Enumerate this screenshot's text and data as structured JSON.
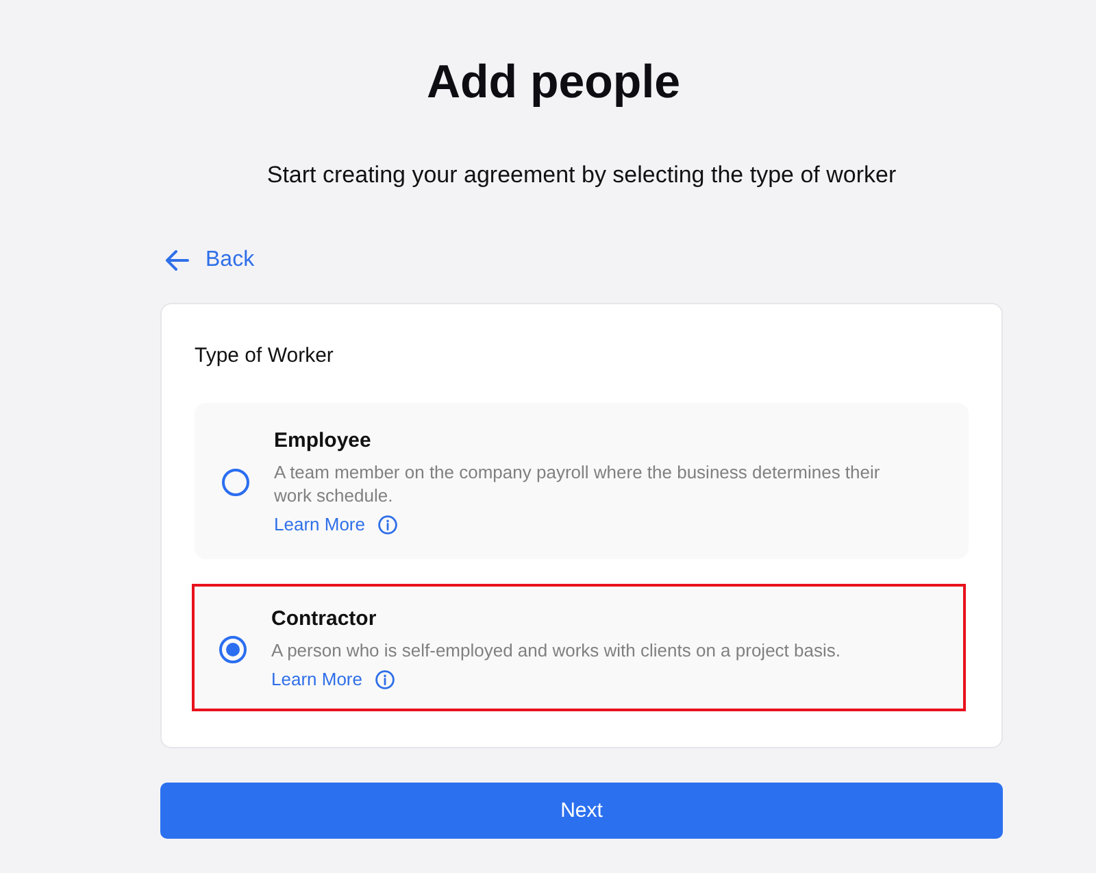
{
  "page": {
    "title": "Add people",
    "subtitle": "Start creating your agreement by selecting the type of worker"
  },
  "back_link": {
    "label": "Back"
  },
  "card": {
    "heading": "Type of Worker",
    "options": [
      {
        "title": "Employee",
        "description": "A team member on the company payroll where the business determines their work schedule.",
        "link": "Learn More",
        "selected": false,
        "highlighted": false
      },
      {
        "title": "Contractor",
        "description": "A person who is self-employed and works with clients on a project basis.",
        "link": "Learn More",
        "selected": true,
        "highlighted": true
      }
    ]
  },
  "primary_button": {
    "label": "Next"
  }
}
